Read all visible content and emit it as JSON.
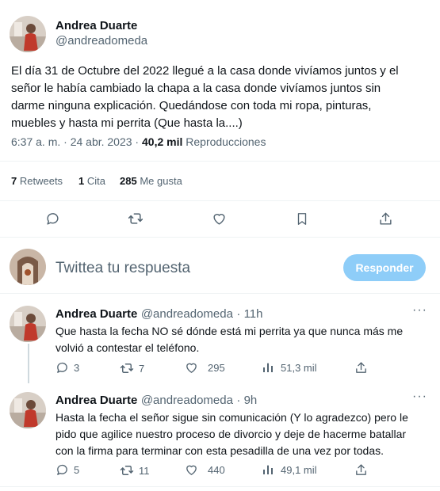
{
  "main_tweet": {
    "author_name": "Andrea Duarte",
    "author_handle": "@andreadomeda",
    "text_lines": [
      "El día 31 de Octubre del 2022 llegué a la casa donde vivíamos juntos y el",
      "señor le había cambiado la chapa a la casa donde vivíamos juntos sin",
      "darme ninguna explicación. Quedándose con toda mi ropa, pinturas,",
      "muebles y hasta mi perrita (Que hasta la....)"
    ],
    "timestamp": "6:37 a. m. · 24 abr. 2023 ·",
    "views_count": "40,2 mil",
    "views_label": "Reproducciones",
    "stats": {
      "retweets_count": "7",
      "retweets_label": "Retweets",
      "quotes_count": "1",
      "quotes_label": "Cita",
      "likes_count": "285",
      "likes_label": "Me gusta"
    },
    "icons": [
      "reply-icon",
      "retweet-icon",
      "like-icon",
      "bookmark-icon",
      "share-icon"
    ]
  },
  "reply_box": {
    "placeholder": "Twittea tu respuesta",
    "button_label": "Responder"
  },
  "replies": [
    {
      "author_name": "Andrea Duarte",
      "author_handle": "@andreadomeda",
      "time": "· 11h",
      "text_lines": [
        "Que hasta la fecha NO sé dónde está mi perrita ya que nunca más me",
        "volvió a contestar el teléfono."
      ],
      "replies_count": "3",
      "retweets_count": "7",
      "likes_count": "295",
      "views_count": "51,3 mil"
    },
    {
      "author_name": "Andrea Duarte",
      "author_handle": "@andreadomeda",
      "time": "· 9h",
      "text_lines": [
        "Hasta la fecha el señor sigue sin comunicación (Y lo agradezco) pero le",
        "pido que agilice nuestro proceso de divorcio y deje de hacerme batallar",
        "con la firma para terminar con esta pesadilla de una vez por todas."
      ],
      "replies_count": "5",
      "retweets_count": "11",
      "likes_count": "440",
      "views_count": "49,1 mil"
    }
  ],
  "colors": {
    "text_primary": "#0f1419",
    "text_secondary": "#536471",
    "accent_disabled": "#8ecdf8",
    "divider": "#eff3f4"
  }
}
